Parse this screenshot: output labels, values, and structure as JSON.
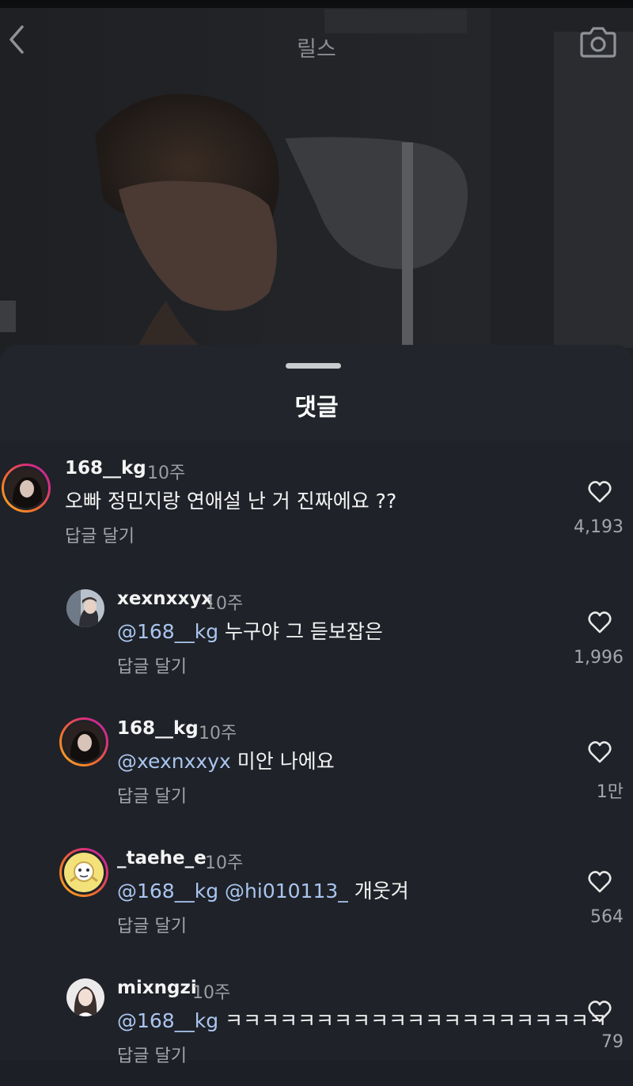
{
  "header": {
    "title": "릴스",
    "back_icon": "chevron-left-icon",
    "camera_icon": "camera-icon"
  },
  "sheet": {
    "title": "댓글"
  },
  "colors": {
    "mention": "#a9c5ef",
    "sheet_bg": "#1f2228",
    "story_ring": [
      "#f9b022",
      "#d92e7a",
      "#b027b3"
    ]
  },
  "comments": [
    {
      "username": "168__kg",
      "time": "10주",
      "mentions": [],
      "text": "오빠 정민지랑 연애설 난 거 진짜에요 ??",
      "reply_label": "답글 달기",
      "likes": "4,193"
    },
    {
      "username": "xexnxxyx",
      "time": "10주",
      "mentions": [
        "@168__kg"
      ],
      "text": "누구야 그 듣보잡은",
      "reply_label": "답글 달기",
      "likes": "1,996"
    },
    {
      "username": "168__kg",
      "time": "10주",
      "mentions": [
        "@xexnxxyx"
      ],
      "text": "미안 나에요",
      "reply_label": "답글 달기",
      "likes": "1만"
    },
    {
      "username": "_taehe_e",
      "time": "10주",
      "mentions": [
        "@168__kg",
        "@hi010113_"
      ],
      "text": "개웃겨",
      "reply_label": "답글 달기",
      "likes": "564"
    },
    {
      "username": "mixngzi",
      "time": "10주",
      "mentions": [
        "@168__kg"
      ],
      "text": "ㅋㅋㅋㅋㅋㅋㅋㅋㅋㅋㅋㅋㅋㅋㅋㅋㅋㅋㅋㅋㅋ",
      "reply_label": "답글 달기",
      "likes": "79"
    }
  ]
}
